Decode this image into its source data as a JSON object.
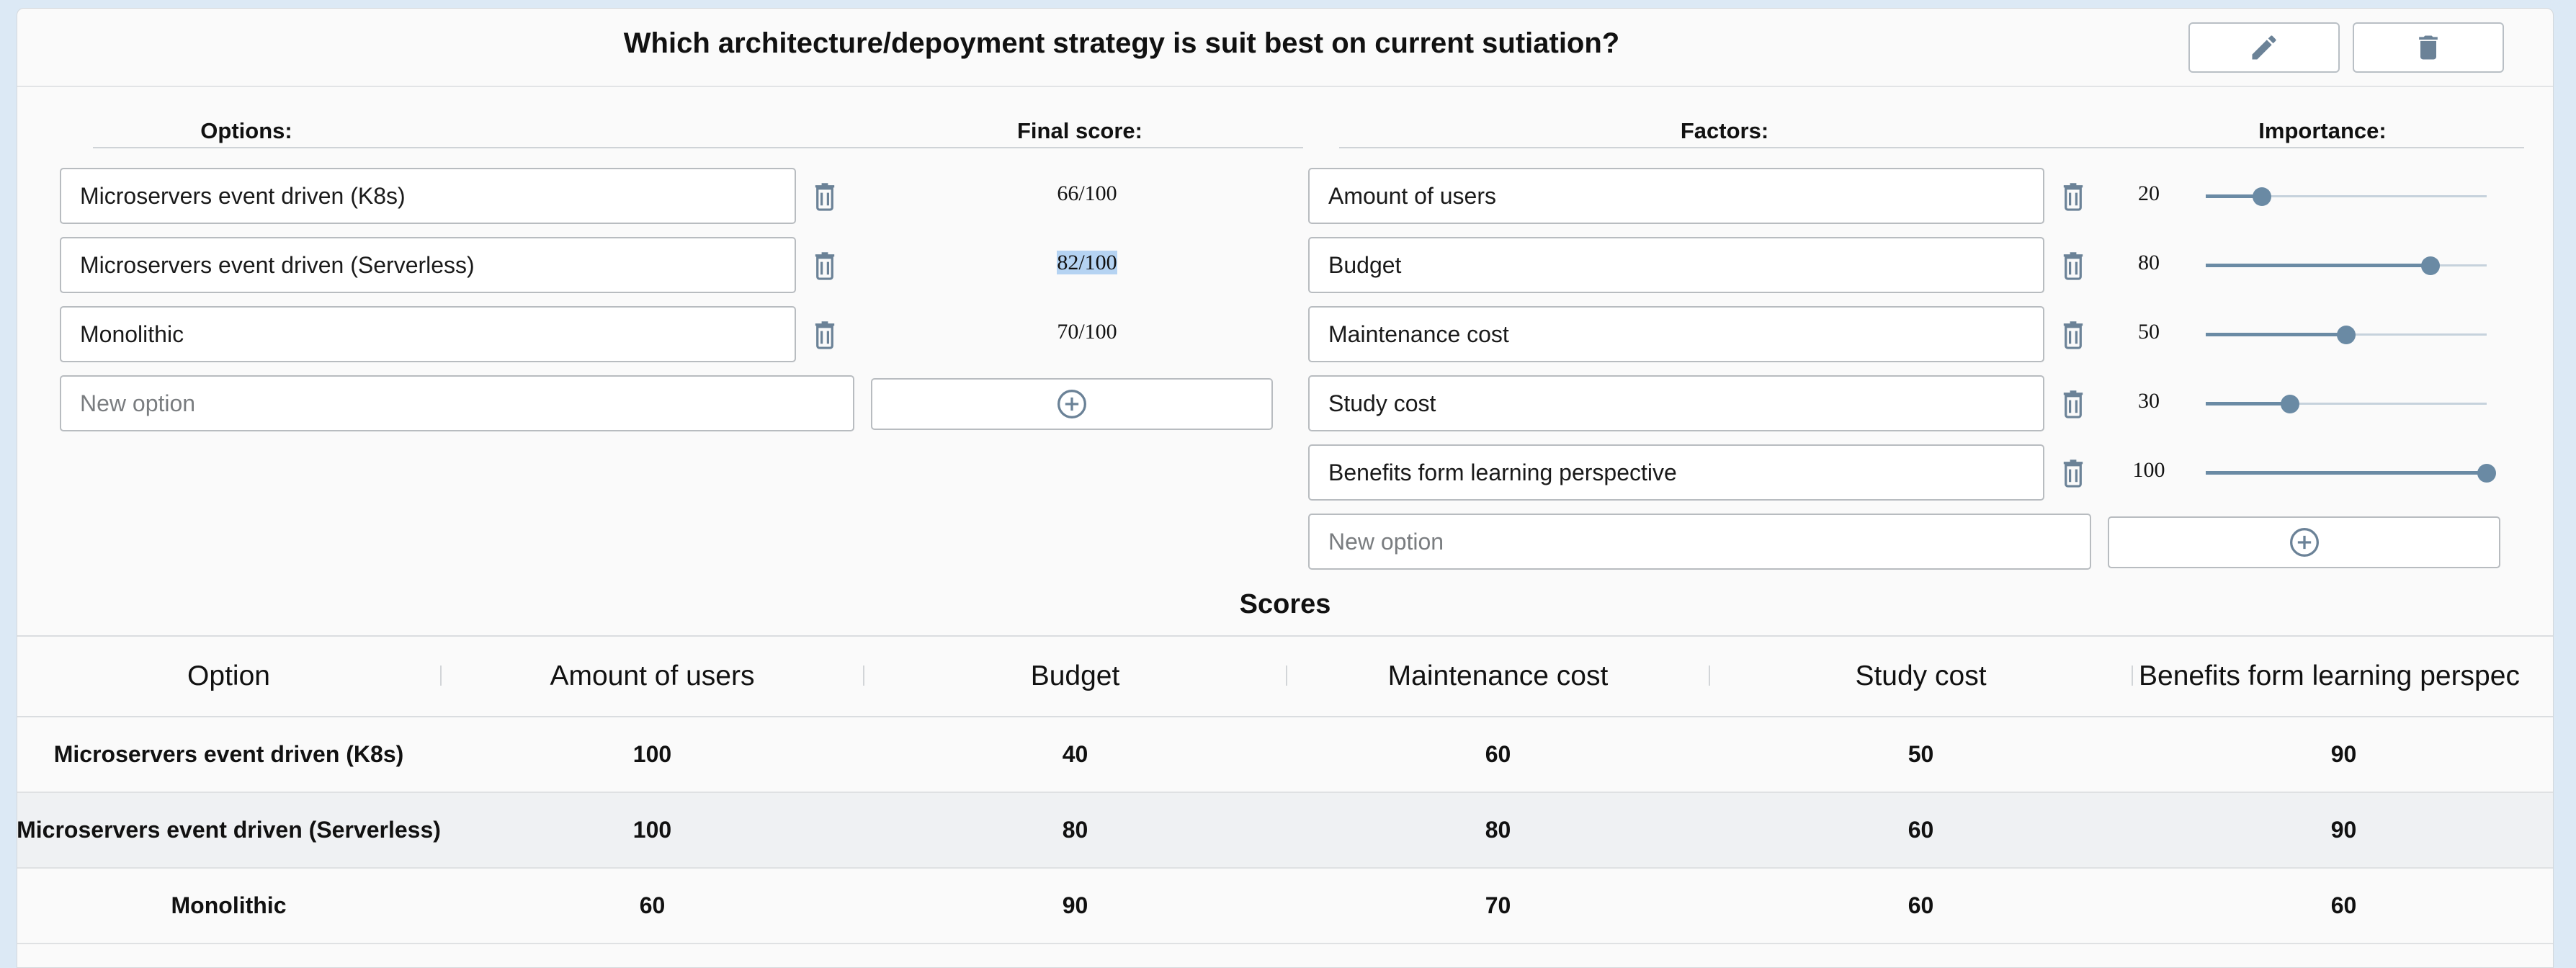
{
  "question": "Which architecture/depoyment strategy is suit best on current sutiation?",
  "options_header": "Options:",
  "final_score_header": "Final score:",
  "factors_header": "Factors:",
  "importance_header": "Importance:",
  "options": [
    {
      "name": "Microservers event driven (K8s)",
      "score": "66/100"
    },
    {
      "name": "Microservers event driven (Serverless)",
      "score": "82/100"
    },
    {
      "name": "Monolithic",
      "score": "70/100"
    }
  ],
  "new_option_placeholder": "New option",
  "factors": [
    {
      "name": "Amount of users",
      "importance": "20",
      "level": 20
    },
    {
      "name": "Budget",
      "importance": "80",
      "level": 80
    },
    {
      "name": "Maintenance cost",
      "importance": "50",
      "level": 50
    },
    {
      "name": "Study cost",
      "importance": "30",
      "level": 30
    },
    {
      "name": "Benefits form learning perspective",
      "importance": "100",
      "level": 100
    }
  ],
  "new_factor_placeholder": "New option",
  "scores_title": "Scores",
  "table": {
    "columns": [
      "Option",
      "Amount of users",
      "Budget",
      "Maintenance cost",
      "Study cost",
      "Benefits form learning perspec"
    ],
    "rows": [
      [
        "Microservers event driven (K8s)",
        "100",
        "40",
        "60",
        "50",
        "90"
      ],
      [
        "Microservers event driven (Serverless)",
        "100",
        "80",
        "80",
        "60",
        "90"
      ],
      [
        "Monolithic",
        "60",
        "90",
        "70",
        "60",
        "60"
      ]
    ]
  },
  "icons": {
    "edit": "pencil-icon",
    "delete": "trash-icon",
    "add": "plus-circle-icon"
  },
  "colors": {
    "accent": "#6a8aa4",
    "icon": "#6b8297",
    "highlight": "#b5d3f2"
  }
}
